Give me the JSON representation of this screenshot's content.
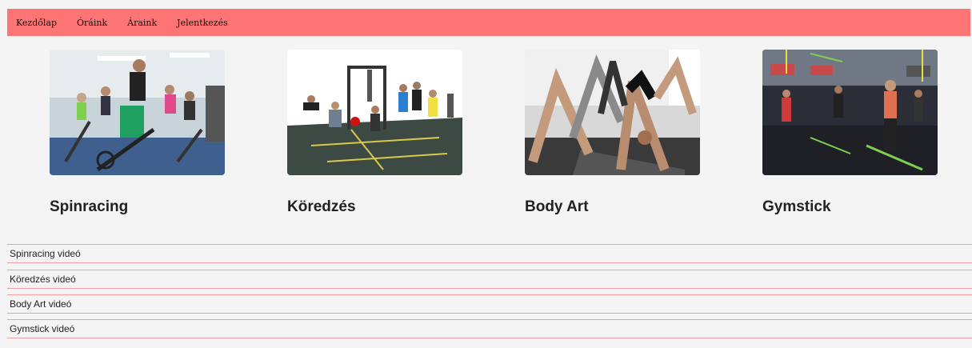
{
  "nav": {
    "items": [
      {
        "label": "Kezdőlap"
      },
      {
        "label": "Óráink"
      },
      {
        "label": "Áraink"
      },
      {
        "label": "Jelentkezés"
      }
    ]
  },
  "classes": [
    {
      "title": "Spinracing"
    },
    {
      "title": "Köredzés"
    },
    {
      "title": "Body Art"
    },
    {
      "title": "Gymstick"
    }
  ],
  "videos": [
    {
      "label": "Spinracing videó"
    },
    {
      "label": "Köredzés videó"
    },
    {
      "label": "Body Art videó"
    },
    {
      "label": "Gymstick videó"
    }
  ],
  "colors": {
    "nav_bg": "#ff7575",
    "row_border": "#f0a0a0",
    "page_bg": "#f4f4f4"
  }
}
